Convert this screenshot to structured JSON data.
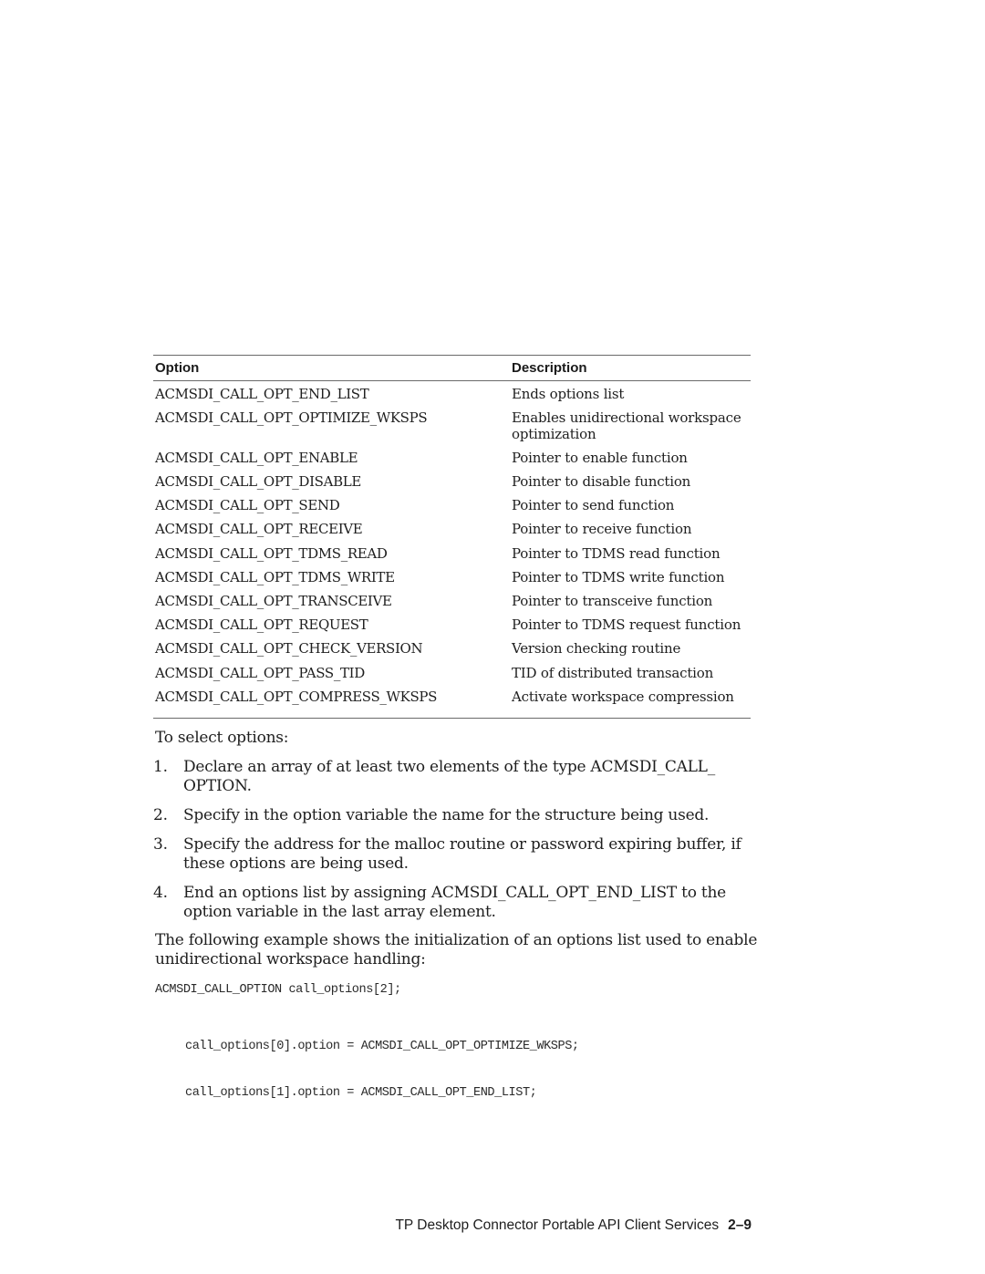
{
  "table": {
    "headers": {
      "option": "Option",
      "description": "Description"
    },
    "rows": [
      {
        "option": "ACMSDI_CALL_OPT_END_LIST",
        "description": "Ends options list"
      },
      {
        "option": "ACMSDI_CALL_OPT_OPTIMIZE_WKSPS",
        "description": "Enables unidirectional workspace optimization"
      },
      {
        "option": "ACMSDI_CALL_OPT_ENABLE",
        "description": "Pointer to enable function"
      },
      {
        "option": "ACMSDI_CALL_OPT_DISABLE",
        "description": "Pointer to disable function"
      },
      {
        "option": "ACMSDI_CALL_OPT_SEND",
        "description": "Pointer to send function"
      },
      {
        "option": "ACMSDI_CALL_OPT_RECEIVE",
        "description": "Pointer to receive function"
      },
      {
        "option": "ACMSDI_CALL_OPT_TDMS_READ",
        "description": "Pointer to TDMS read function"
      },
      {
        "option": "ACMSDI_CALL_OPT_TDMS_WRITE",
        "description": "Pointer to TDMS write function"
      },
      {
        "option": "ACMSDI_CALL_OPT_TRANSCEIVE",
        "description": "Pointer to transceive function"
      },
      {
        "option": "ACMSDI_CALL_OPT_REQUEST",
        "description": "Pointer to TDMS request function"
      },
      {
        "option": "ACMSDI_CALL_OPT_CHECK_VERSION",
        "description": "Version checking routine"
      },
      {
        "option": "ACMSDI_CALL_OPT_PASS_TID",
        "description": "TID of distributed transaction"
      },
      {
        "option": "ACMSDI_CALL_OPT_COMPRESS_WKSPS",
        "description": "Activate workspace compression"
      }
    ]
  },
  "intro": "To select options:",
  "steps": [
    {
      "num": "1.",
      "text": "Declare an array of at least two elements of the type ACMSDI_CALL_ OPTION."
    },
    {
      "num": "2.",
      "text": "Specify in the option variable the name for the structure being used."
    },
    {
      "num": "3.",
      "text": "Specify the address for the malloc routine or password expiring buffer, if these options are being used."
    },
    {
      "num": "4.",
      "text": "End an options list by assigning ACMSDI_CALL_OPT_END_LIST to the option variable in the last array element."
    }
  ],
  "example_intro": "The following example shows the initialization of an options list used to enable unidirectional workspace handling:",
  "code": {
    "declaration": "ACMSDI_CALL_OPTION call_options[2];",
    "lines": [
      "call_options[0].option = ACMSDI_CALL_OPT_OPTIMIZE_WKSPS;",
      "call_options[1].option = ACMSDI_CALL_OPT_END_LIST;"
    ]
  },
  "footer": {
    "title": "TP Desktop Connector Portable API Client Services",
    "page_number": "2–9"
  }
}
